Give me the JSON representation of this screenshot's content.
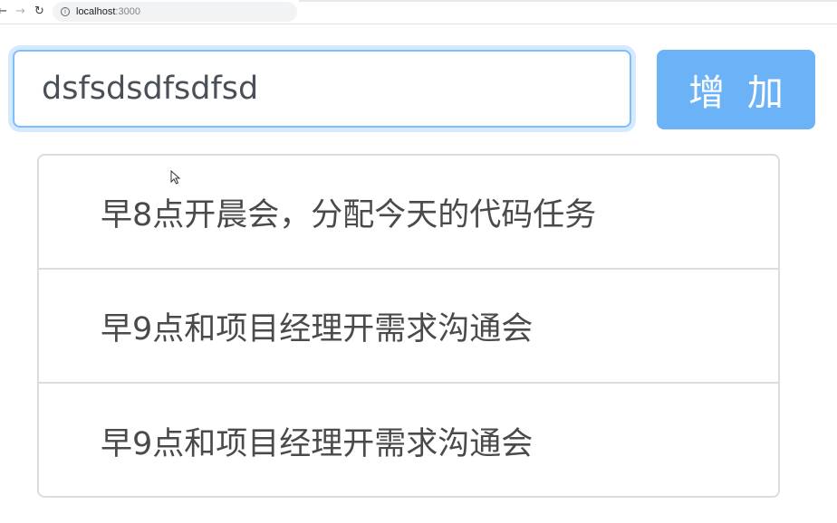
{
  "browser": {
    "url_host": "localhost",
    "url_port": ":3000",
    "back_icon": "arrow-left-icon",
    "forward_icon": "arrow-right-icon",
    "reload_icon": "reload-icon",
    "info_icon": "info-icon"
  },
  "form": {
    "input_value": "dsfsdsdfsdfsd",
    "add_label": "增 加"
  },
  "tasks": [
    {
      "text": "早8点开晨会，分配今天的代码任务"
    },
    {
      "text": "早9点和项目经理开需求沟通会"
    },
    {
      "text": "早9点和项目经理开需求沟通会"
    }
  ],
  "colors": {
    "button_bg": "#6cb2f7",
    "input_focus_border": "#80bdff",
    "list_border": "#dcdcdc"
  }
}
